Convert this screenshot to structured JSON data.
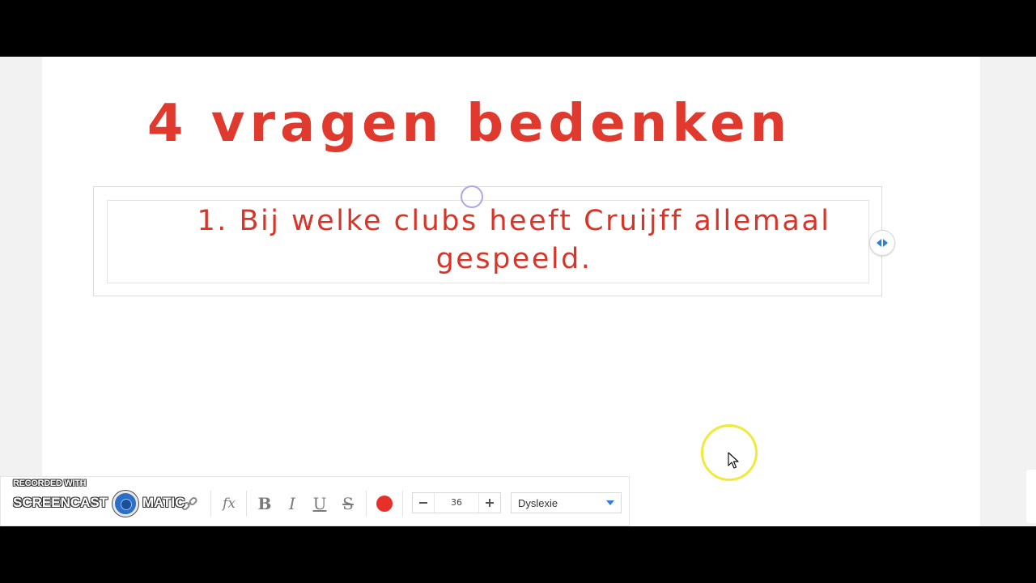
{
  "slide": {
    "title": "4 vragen bedenken",
    "question_line1": "1. Bij welke clubs heeft Cruijff allemaal",
    "question_line2": "gespeeld."
  },
  "toolbar": {
    "fx_label": "fx",
    "bold_label": "B",
    "italic_label": "I",
    "underline_label": "U",
    "strike_label": "S",
    "text_color": "#e8302a",
    "font_size": "36",
    "font_name": "Dyslexie"
  },
  "watermark": {
    "line1": "RECORDED WITH",
    "line2_left": "SCREENCAST",
    "line2_right": "MATIC"
  },
  "colors": {
    "title": "#e03a2f",
    "accent_blue": "#2f7fd8",
    "highlight_yellow": "#f0ea3c"
  }
}
